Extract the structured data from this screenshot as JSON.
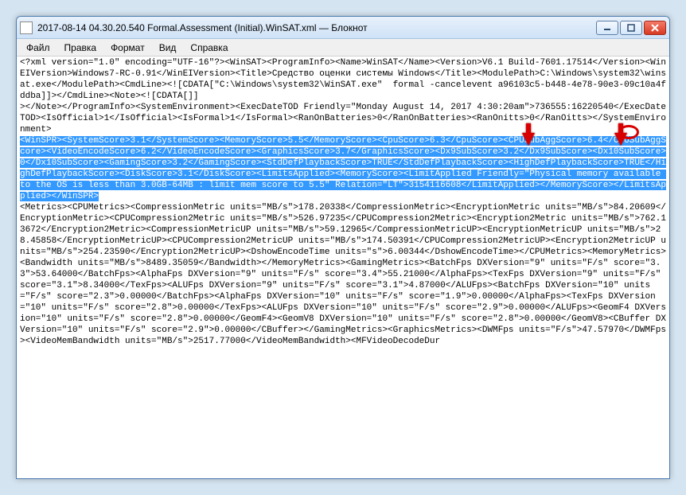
{
  "window": {
    "title": "2017-08-14 04.30.20.540 Formal.Assessment (Initial).WinSAT.xml — Блокнот"
  },
  "menu": {
    "file": "Файл",
    "edit": "Правка",
    "format": "Формат",
    "view": "Вид",
    "help": "Справка"
  },
  "lines": {
    "l1": "<?xml version=\"1.0\" encoding=\"UTF-16\"?><WinSAT><ProgramInfo><Name>WinSAT</Name><Version>V6.1 Build-7601.17514</Version><WinEIVersion>Windows7-RC-0.91</WinEIVersion><Title>Средство оценки системы Windows</Title><ModulePath>C:\\Windows\\system32\\winsat.exe</ModulePath><CmdLine><![CDATA[\"C:\\Windows\\system32\\WinSAT.exe\"  formal -cancelevent a96103c5-b448-4e78-90e3-09c10a4fddba]]></CmdLine><Note><![CDATA[]]",
    "l2": "></Note></ProgramInfo><SystemEnvironment><ExecDateTOD Friendly=\"Monday August 14, 2017 4:30:20am\">736555:16220540</ExecDateTOD><IsOfficial>1</IsOfficial><IsFormal>1</IsFormal><RanOnBatteries>0</RanOnBatteries><RanOnitts>0</RanOitts></SystemEnvironment>",
    "s_a": "<WinSPR><SystemScore>",
    "s_b": "3.1",
    "s_c": "</SystemScore><MemoryScore>5.5</MemoryScore><CpuScore>6.3</CpuScore><CPUSubAggScore>6.4</CPUSubAggScore><VideoEncodeScore>6.2</VideoEncodeScore><GraphicsScore>3.7</GraphicsScore><Dx9SubScore>3.2</Dx9SubScore><Dx10SubScore>0</Dx10SubScore><GamingScore>3.2</GamingScore><StdDefPlaybackScore>TRUE</StdDefPlaybackScore><HighDefPlaybackScore>TRUE</HighDefPlaybackScore><DiskScore>3.1</DiskScore><LimitsApplied><MemoryScore><LimitApplied Friendly=\"Physical memory available to the OS is less than 3.0GB-64MB : limit mem score to 5.5\" Relation=\"LT\">3154116608</LimitApplied></MemoryScore></LimitsApplied></WinSPR>",
    "l3": "<Metrics><CPUMetrics><CompressionMetric units=\"MB/s\">178.20338</CompressionMetric><EncryptionMetric units=\"MB/s\">84.20609</EncryptionMetric><CPUCompression2Metric units=\"MB/s\">526.97235</CPUCompression2Metric><Encryption2Metric units=\"MB/s\">762.13672</Encryption2Metric><CompressionMetricUP units=\"MB/s\">59.12965</CompressionMetricUP><EncryptionMetricUP units=\"MB/s\">28.45858</EncryptionMetricUP><CPUCompression2MetricUP units=\"MB/s\">174.50391</CPUCompression2MetricUP><Encryption2MetricUP units=\"MB/s\">254.23590</Encryption2MetricUP><DshowEncodeTime units=\"s\">6.00344</DshowEncodeTime></CPUMetrics><MemoryMetrics><Bandwidth units=\"MB/s\">8489.35059</Bandwidth></MemoryMetrics><GamingMetrics><BatchFps DXVersion=\"9\" units=\"F/s\" score=\"3.3\">53.64000</BatchFps><AlphaFps DXVersion=\"9\" units=\"F/s\" score=\"3.4\">55.21000</AlphaFps><TexFps DXVersion=\"9\" units=\"F/s\" score=\"3.1\">8.34000</TexFps><ALUFps DXVersion=\"9\" units=\"F/s\" score=\"3.1\">4.87000</ALUFps><BatchFps DXVersion=\"10\" units=\"F/s\" score=\"2.3\">0.00000</BatchFps><AlphaFps DXVersion=\"10\" units=\"F/s\" score=\"1.9\">0.00000</AlphaFps><TexFps DXVersion=\"10\" units=\"F/s\" score=\"2.8\">0.00000</TexFps><ALUFps DXVersion=\"10\" units=\"F/s\" score=\"2.9\">0.00000</ALUFps><GeomF4 DXVersion=\"10\" units=\"F/s\" score=\"2.8\">0.00000</GeomF4><GeomV8 DXVersion=\"10\" units=\"F/s\" score=\"2.8\">0.00000</GeomV8><CBuffer DXVersion=\"10\" units=\"F/s\" score=\"2.9\">0.00000</CBuffer></GamingMetrics><GraphicsMetrics><DWMFps units=\"F/s\">47.57970</DWMFps><VideoMemBandwidth units=\"MB/s\">2517.77000</VideoMemBandwidth><MFVideoDecodeDur"
  }
}
